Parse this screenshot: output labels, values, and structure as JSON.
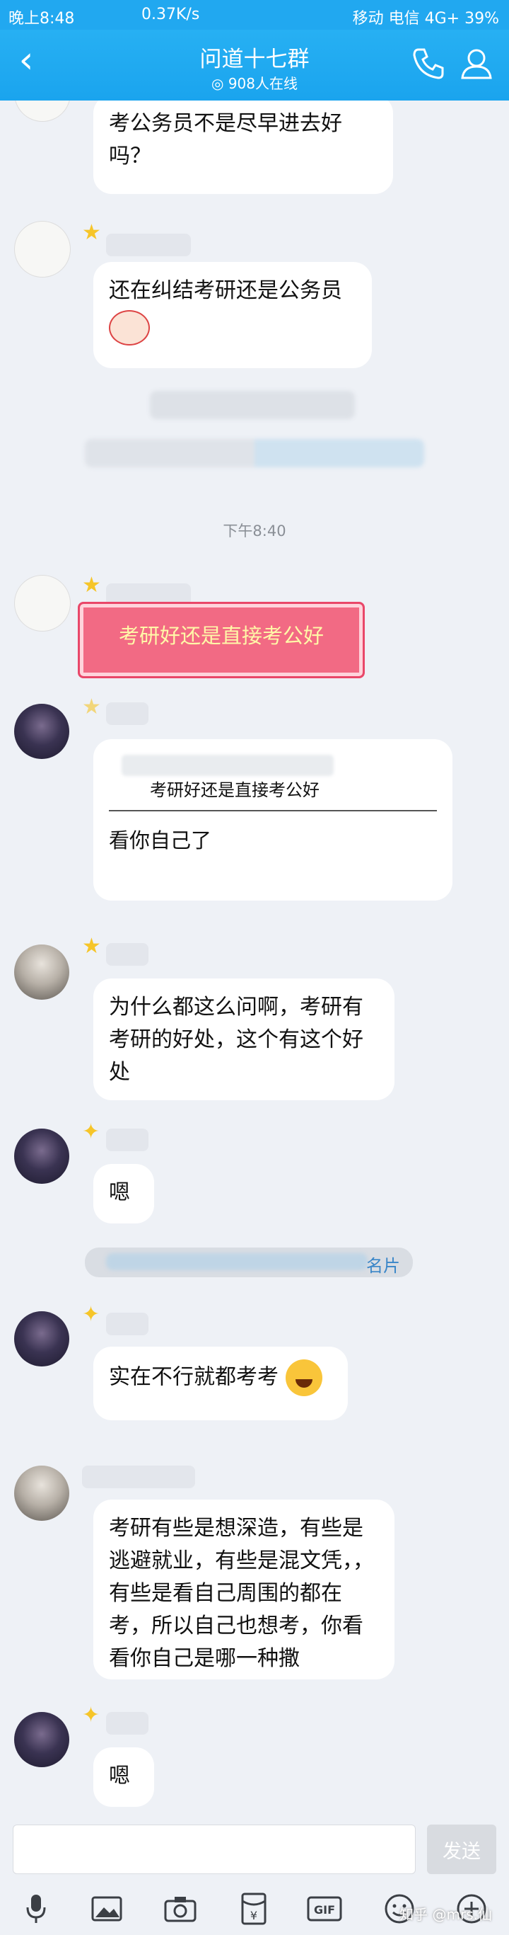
{
  "status_bar": {
    "left": "晚上8:48",
    "middle": "0.37K/s",
    "right": "移动  电信 4G+  39%"
  },
  "header": {
    "title": "问道十七群",
    "online": "908人在线"
  },
  "chat": {
    "msg1": "考公务员不是尽早进去好吗？",
    "msg2": "还在纠结考研还是公务员",
    "time1": "下午8:40",
    "sticker": "考研好还是直接考公好",
    "quote": "考研好还是直接考公好",
    "reply": "看你自己了",
    "msg3": "为什么都这么问啊，考研有考研的好处，这个有这个好处",
    "msg4": "嗯",
    "card_suffix": "名片",
    "msg5": "实在不行就都考考",
    "msg6": "考研有些是想深造，有些是逃避就业，有些是混文凭，，有些是看自己周围的都在考，所以自己也想考，你看看你自己是哪一种撒",
    "msg7": "嗯"
  },
  "input": {
    "placeholder": "",
    "send": "发送"
  },
  "watermark": "知乎 @mrs.仙"
}
